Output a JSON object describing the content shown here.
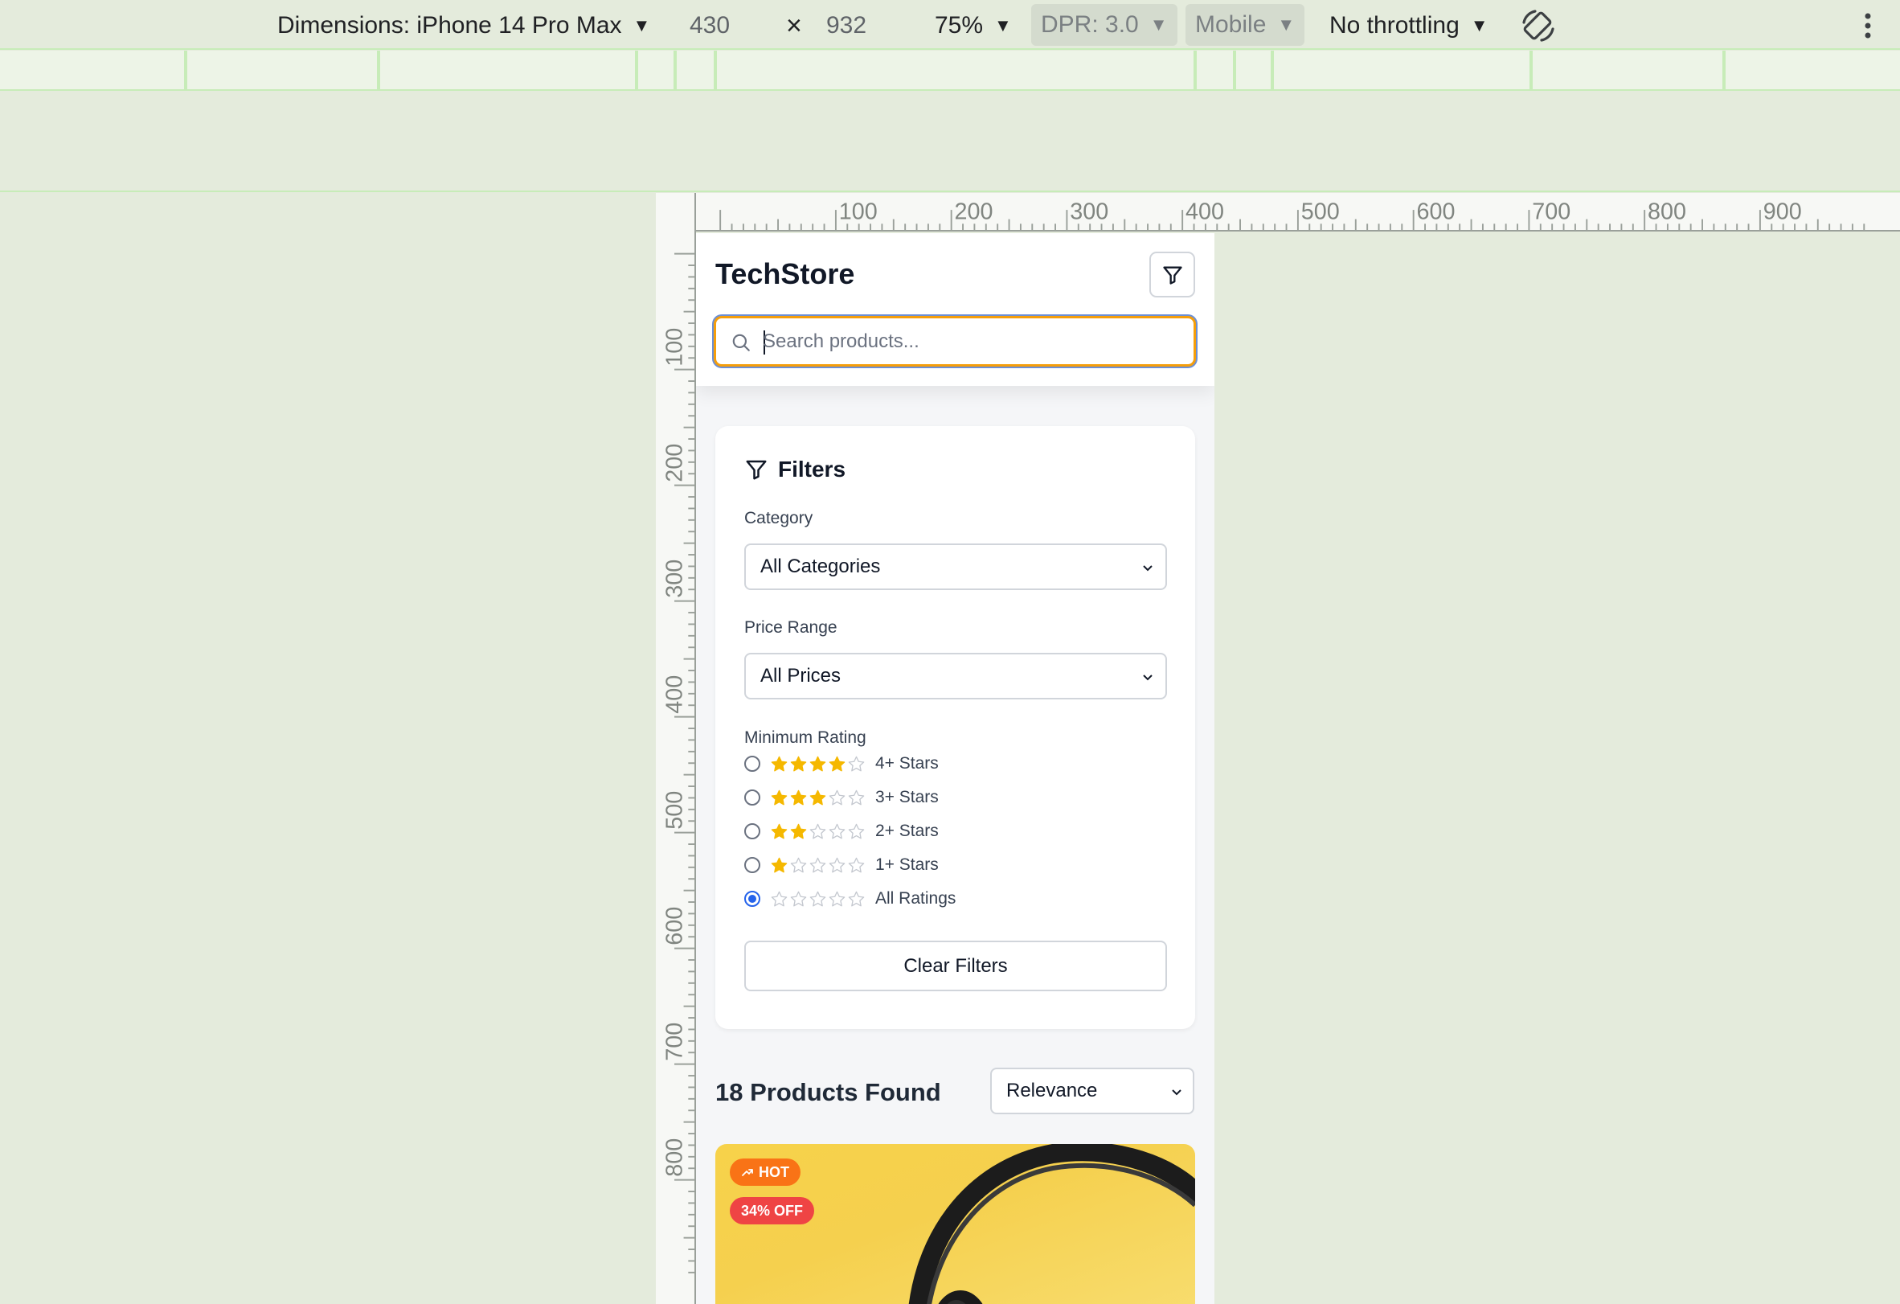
{
  "devtools": {
    "dimensions_label": "Dimensions: iPhone 14 Pro Max",
    "width": "430",
    "times": "×",
    "height": "932",
    "zoom": "75%",
    "dpr": "DPR: 3.0",
    "mode": "Mobile",
    "throttling": "No throttling",
    "rotate_icon": "rotate-icon",
    "more_icon": "more-vert-icon"
  },
  "rulers": {
    "horizontal": [
      "100",
      "200",
      "300",
      "400",
      "500",
      "600",
      "700",
      "800",
      "900"
    ],
    "vertical": [
      "100",
      "200",
      "300",
      "400",
      "500",
      "600",
      "700",
      "800"
    ]
  },
  "header": {
    "brand": "TechStore",
    "filter_icon": "filter-icon",
    "search_placeholder": "Search products...",
    "search_value": ""
  },
  "filters": {
    "title": "Filters",
    "category_label": "Category",
    "category_value": "All Categories",
    "price_label": "Price Range",
    "price_value": "All Prices",
    "rating_label": "Minimum Rating",
    "ratings": [
      {
        "label": "4+ Stars",
        "stars": 4,
        "selected": false
      },
      {
        "label": "3+ Stars",
        "stars": 3,
        "selected": false
      },
      {
        "label": "2+ Stars",
        "stars": 2,
        "selected": false
      },
      {
        "label": "1+ Stars",
        "stars": 1,
        "selected": false
      },
      {
        "label": "All Ratings",
        "stars": 0,
        "selected": true
      }
    ],
    "clear_label": "Clear Filters"
  },
  "results": {
    "count_label": "18 Products Found",
    "sort_value": "Relevance"
  },
  "product": {
    "hot_badge": "HOT",
    "discount_badge": "34% OFF"
  },
  "colors": {
    "accent_orange": "#f97316",
    "sale_red": "#ef4444",
    "star_yellow": "#f5b800",
    "radio_blue": "#2563eb",
    "focus_border": "#f59e0b"
  }
}
